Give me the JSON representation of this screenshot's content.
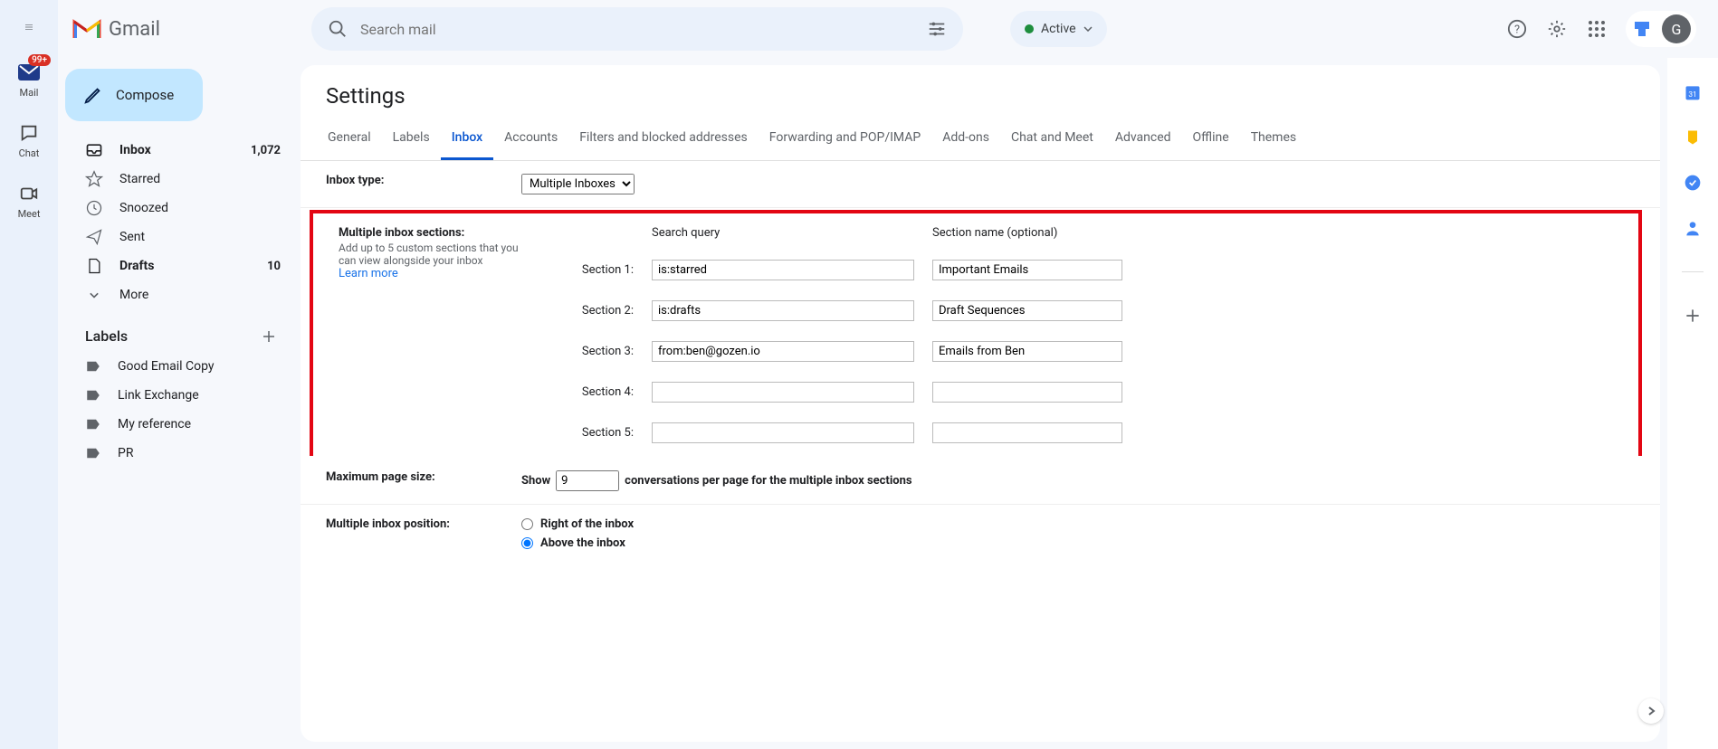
{
  "rail": {
    "items": [
      {
        "label": "Mail",
        "badge": "99+"
      },
      {
        "label": "Chat"
      },
      {
        "label": "Meet"
      }
    ]
  },
  "header": {
    "app_name": "Gmail",
    "search_placeholder": "Search mail",
    "status": "Active",
    "avatar_initial": "G"
  },
  "sidebar": {
    "compose": "Compose",
    "nav": [
      {
        "label": "Inbox",
        "count": "1,072",
        "bold": true
      },
      {
        "label": "Starred"
      },
      {
        "label": "Snoozed"
      },
      {
        "label": "Sent"
      },
      {
        "label": "Drafts",
        "count": "10",
        "bold": true
      },
      {
        "label": "More"
      }
    ],
    "labels_title": "Labels",
    "labels": [
      {
        "label": "Good Email Copy"
      },
      {
        "label": "Link Exchange"
      },
      {
        "label": "My reference"
      },
      {
        "label": "PR"
      }
    ]
  },
  "settings": {
    "title": "Settings",
    "tabs": [
      "General",
      "Labels",
      "Inbox",
      "Accounts",
      "Filters and blocked addresses",
      "Forwarding and POP/IMAP",
      "Add-ons",
      "Chat and Meet",
      "Advanced",
      "Offline",
      "Themes"
    ],
    "active_tab": "Inbox",
    "inbox_type": {
      "label": "Inbox type:",
      "value": "Multiple Inboxes"
    },
    "sections": {
      "label": "Multiple inbox sections:",
      "desc": "Add up to 5 custom sections that you can view alongside your inbox",
      "learn_more": "Learn more",
      "col_query": "Search query",
      "col_name": "Section name (optional)",
      "rows": [
        {
          "n": "Section 1:",
          "q": "is:starred",
          "name": "Important Emails"
        },
        {
          "n": "Section 2:",
          "q": "is:drafts",
          "name": "Draft Sequences"
        },
        {
          "n": "Section 3:",
          "q": "from:ben@gozen.io",
          "name": "Emails from Ben"
        },
        {
          "n": "Section 4:",
          "q": "",
          "name": ""
        },
        {
          "n": "Section 5:",
          "q": "",
          "name": ""
        }
      ]
    },
    "page_size": {
      "label": "Maximum page size:",
      "prefix": "Show",
      "value": "9",
      "suffix": "conversations per page for the multiple inbox sections"
    },
    "position": {
      "label": "Multiple inbox position:",
      "options": [
        {
          "label": "Right of the inbox",
          "checked": false
        },
        {
          "label": "Above the inbox",
          "checked": true
        }
      ]
    }
  }
}
